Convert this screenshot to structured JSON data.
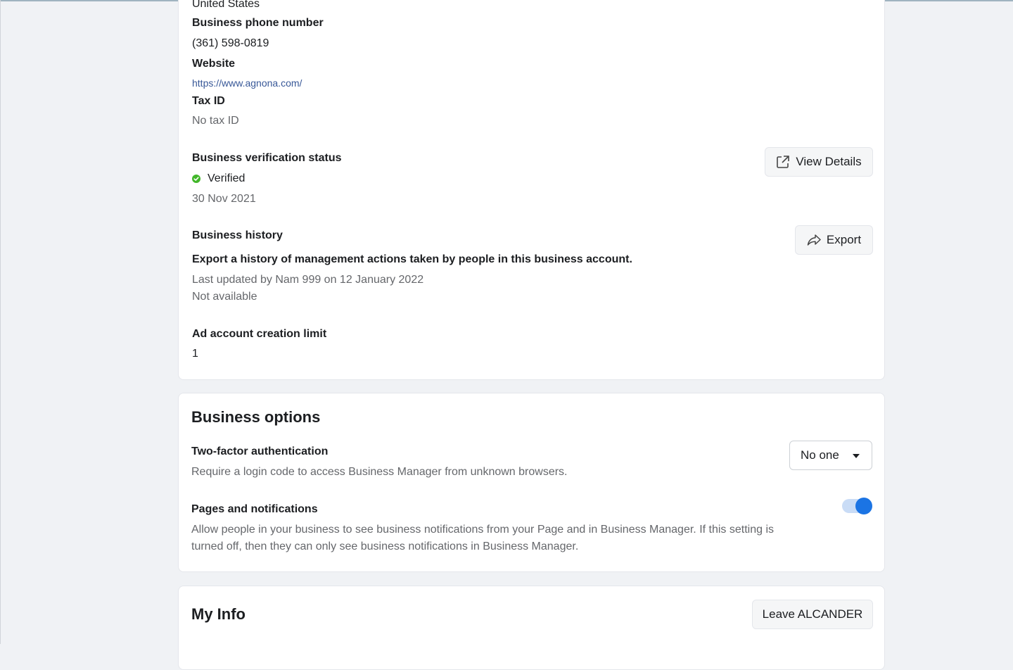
{
  "business_info": {
    "country_value": "United States",
    "phone_label": "Business phone number",
    "phone_value": "(361) 598-0819",
    "website_label": "Website",
    "website_value": "https://www.agnona.com/",
    "tax_label": "Tax ID",
    "tax_value": "No tax ID",
    "verification_label": "Business verification status",
    "verification_status": "Verified",
    "verification_date": "30 Nov 2021",
    "view_details_label": "View Details",
    "history_label": "Business history",
    "history_description": "Export a history of management actions taken by people in this business account.",
    "history_updated": "Last updated by Nam 999 on 12 January 2022",
    "history_availability": "Not available",
    "export_label": "Export",
    "ad_limit_label": "Ad account creation limit",
    "ad_limit_value": "1"
  },
  "business_options": {
    "title": "Business options",
    "two_factor_label": "Two-factor authentication",
    "two_factor_description": "Require a login code to access Business Manager from unknown browsers.",
    "two_factor_selected": "No one",
    "pages_label": "Pages and notifications",
    "pages_description_line1": "Allow people in your business to see business notifications from your Page and in Business Manager. If this setting is",
    "pages_description_line2": "turned off, then they can only see business notifications in Business Manager.",
    "pages_toggle_on": true
  },
  "my_info": {
    "title": "My Info",
    "leave_label": "Leave ALCANDER"
  },
  "colors": {
    "accent": "#1b74e4",
    "verified": "#42b72a",
    "link": "#385898"
  }
}
